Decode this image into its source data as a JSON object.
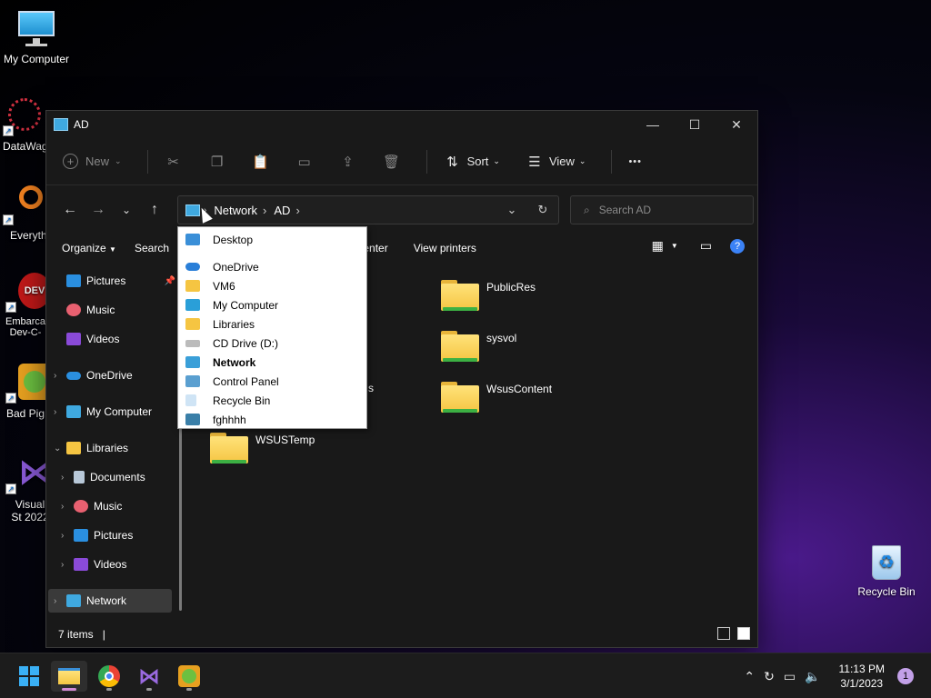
{
  "desktop": {
    "icons": [
      {
        "label": "My Computer"
      },
      {
        "label": "DataWag"
      },
      {
        "label": "Everyth"
      },
      {
        "label": "Embarca Dev-C-"
      },
      {
        "label": "Bad Pig"
      },
      {
        "label": "Visual St 2022"
      },
      {
        "label": "Recycle Bin"
      }
    ]
  },
  "window": {
    "title": "AD",
    "toolbar": {
      "new_label": "New",
      "sort_label": "Sort",
      "view_label": "View",
      "more_label": "•••"
    },
    "address": {
      "crumbs": [
        "Network",
        "AD"
      ],
      "search_placeholder": "Search AD"
    },
    "commands": {
      "organize": "Organize",
      "search": "Search",
      "network_center": "ng Center",
      "view_printers": "View printers",
      "help": "?"
    },
    "sidebar": {
      "items": [
        {
          "label": "Pictures"
        },
        {
          "label": "Music"
        },
        {
          "label": "Videos"
        },
        {
          "label": "OneDrive"
        },
        {
          "label": "My Computer"
        },
        {
          "label": "Libraries"
        },
        {
          "label": "Documents"
        },
        {
          "label": "Music"
        },
        {
          "label": "Pictures"
        },
        {
          "label": "Videos"
        },
        {
          "label": "Network"
        }
      ]
    },
    "content": {
      "folders": [
        {
          "name": "PublicRes"
        },
        {
          "name": "sysvol"
        },
        {
          "name": "WsusContent"
        },
        {
          "name": "WSUSTemp"
        },
        {
          "name": "s"
        }
      ]
    },
    "status": {
      "items": "7 items",
      "sep": "|"
    }
  },
  "dropdown": {
    "items": [
      {
        "label": "Desktop"
      },
      {
        "label": "OneDrive"
      },
      {
        "label": "VM6"
      },
      {
        "label": "My Computer"
      },
      {
        "label": "Libraries"
      },
      {
        "label": "CD Drive (D:)"
      },
      {
        "label": "Network"
      },
      {
        "label": "Control Panel"
      },
      {
        "label": "Recycle Bin"
      },
      {
        "label": "fghhhh"
      }
    ]
  },
  "taskbar": {
    "clock_time": "11:13 PM",
    "clock_date": "3/1/2023",
    "notifications": "1"
  },
  "colors": {
    "accent": "#3b82f6",
    "folder": "#f5c542",
    "window_bg": "#191919"
  }
}
